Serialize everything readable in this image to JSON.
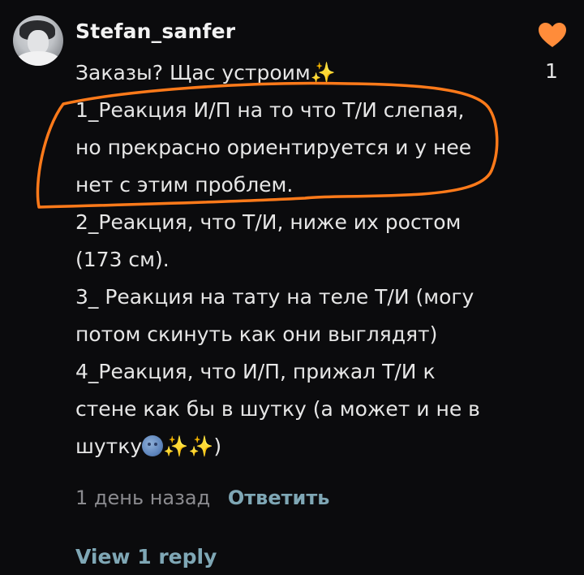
{
  "comment": {
    "username": "Stefan_sanfer",
    "lines": [
      "Заказы? Щас устроим",
      "1_Реакция И/П на то что Т/И слепая,",
      "но прекрасно ориентируется и у нее",
      "нет с этим проблем.",
      "2_Реакция, что Т/И, ниже их ростом",
      "(173 см).",
      "3_ Реакция на тату на теле Т/И (могу",
      "потом скинуть как они выглядят)",
      "4_Реакция, что И/П, прижал Т/И к",
      "стене как бы в шутку (а может и не в",
      "шутку",
      ")"
    ],
    "sparkle_glyph": "✨",
    "like_count": "1",
    "timestamp": "1 день назад",
    "reply_label": "Ответить",
    "view_replies_label": "View 1 reply"
  },
  "colors": {
    "background": "#0b0b0d",
    "heart": "#ff8c3a",
    "highlight_stroke": "#ff7a1a",
    "link": "#7fa7b5",
    "sparkle": "#ffcf33"
  },
  "icons": {
    "like": "heart-icon",
    "emoji_1": "sparkles-icon",
    "emoji_2": "moon-face-icon"
  }
}
